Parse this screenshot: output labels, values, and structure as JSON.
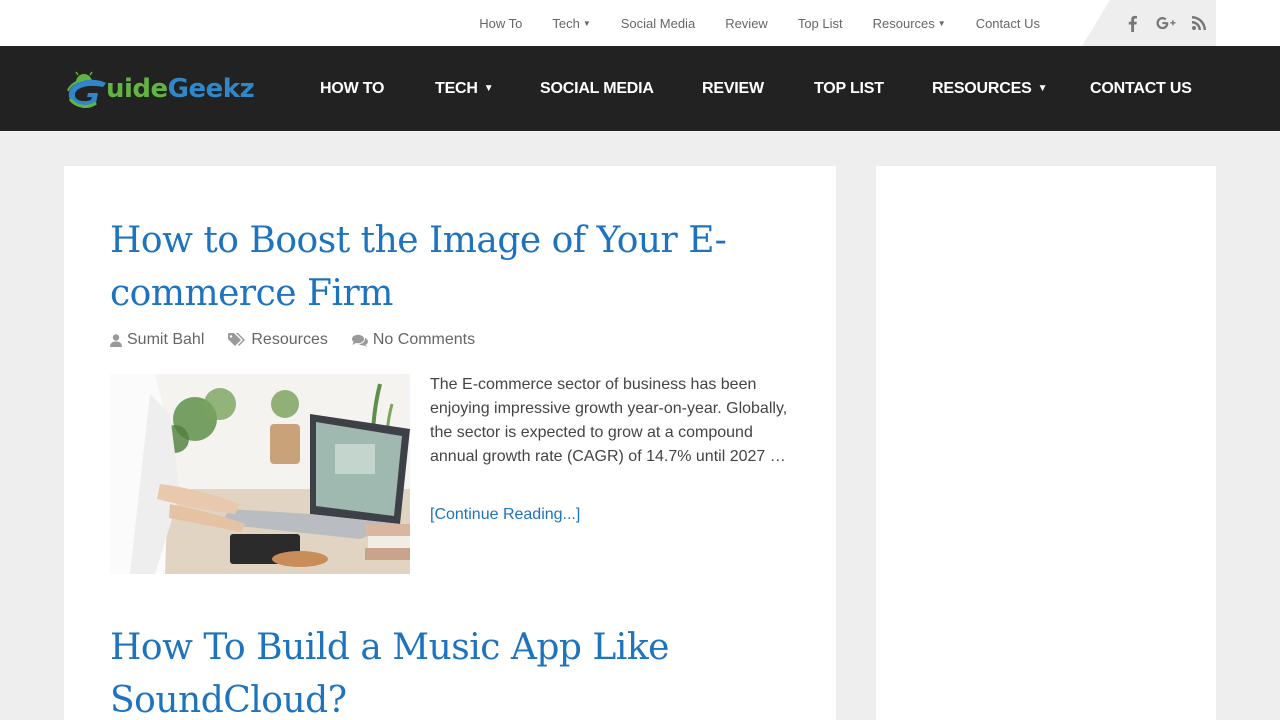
{
  "topnav": {
    "items": [
      {
        "label": "How To",
        "has_dropdown": false
      },
      {
        "label": "Tech",
        "has_dropdown": true
      },
      {
        "label": "Social Media",
        "has_dropdown": false
      },
      {
        "label": "Review",
        "has_dropdown": false
      },
      {
        "label": "Top List",
        "has_dropdown": false
      },
      {
        "label": "Resources",
        "has_dropdown": true
      },
      {
        "label": "Contact Us",
        "has_dropdown": false
      }
    ],
    "social": [
      "facebook-icon",
      "google-plus-icon",
      "rss-icon"
    ]
  },
  "brand": {
    "name_part1": "uide",
    "name_part2": "Geekz",
    "colors": {
      "green": "#62b344",
      "blue": "#2f86c9"
    }
  },
  "mainnav": {
    "items": [
      {
        "label": "HOW TO",
        "has_dropdown": false
      },
      {
        "label": "TECH",
        "has_dropdown": true
      },
      {
        "label": "SOCIAL MEDIA",
        "has_dropdown": false
      },
      {
        "label": "REVIEW",
        "has_dropdown": false
      },
      {
        "label": "TOP LIST",
        "has_dropdown": false
      },
      {
        "label": "RESOURCES",
        "has_dropdown": true
      },
      {
        "label": "CONTACT US",
        "has_dropdown": false
      }
    ]
  },
  "colors": {
    "header_bg": "#222222",
    "link": "#1e73be",
    "page_bg": "#eeeeee"
  },
  "posts": [
    {
      "title": "How to Boost the Image of Your E-commerce Firm",
      "author": "Sumit Bahl",
      "category": "Resources",
      "comments": "No Comments",
      "excerpt": "The E-commerce sector of business has been enjoying impressive growth year-on-year. Globally, the sector is expected to grow at a compound annual growth rate (CAGR) of 14.7% until 2027 …",
      "read_more": "[Continue Reading...]"
    },
    {
      "title": "How To Build a Music App Like SoundCloud?"
    }
  ]
}
